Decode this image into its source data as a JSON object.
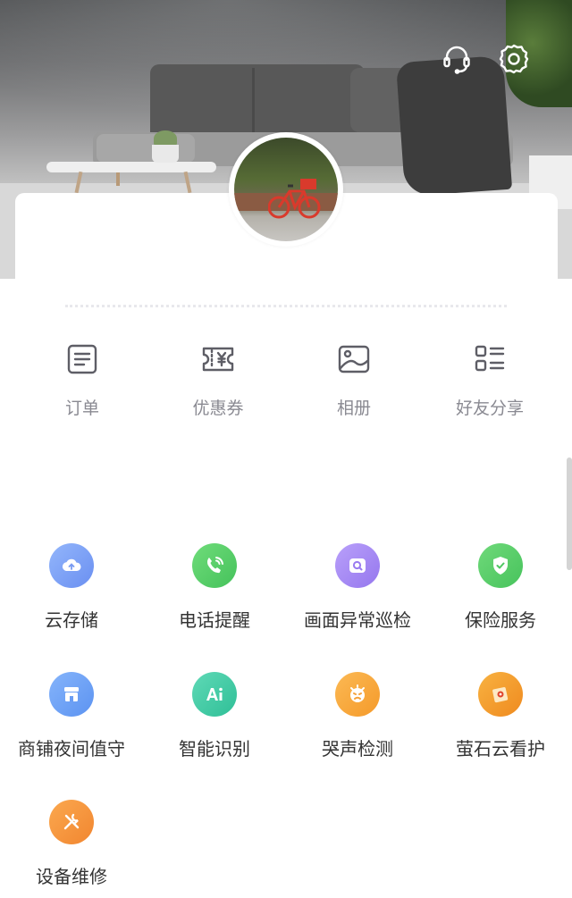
{
  "header": {
    "icons": [
      "headset-icon",
      "settings-icon"
    ]
  },
  "quick_actions": [
    {
      "icon": "orders-icon",
      "label": "订单"
    },
    {
      "icon": "coupon-icon",
      "label": "优惠券"
    },
    {
      "icon": "album-icon",
      "label": "相册"
    },
    {
      "icon": "share-icon",
      "label": "好友分享"
    }
  ],
  "services": [
    {
      "icon": "cloud-storage-icon",
      "label": "云存储",
      "color": "#7fa4f4"
    },
    {
      "icon": "phone-alert-icon",
      "label": "电话提醒",
      "color": "#5bd06c"
    },
    {
      "icon": "screen-check-icon",
      "label": "画面异常巡检",
      "color": "#a98cf3"
    },
    {
      "icon": "shield-icon",
      "label": "保险服务",
      "color": "#58cc67"
    },
    {
      "icon": "store-icon",
      "label": "商铺夜间值守",
      "color": "#6ea4f5"
    },
    {
      "icon": "ai-icon",
      "label": "智能识别",
      "color": "#3fc9a4"
    },
    {
      "icon": "baby-cry-icon",
      "label": "哭声检测",
      "color": "#f7a33c"
    },
    {
      "icon": "ezviz-care-icon",
      "label": "萤石云看护",
      "color": "#f49a2c"
    },
    {
      "icon": "repair-icon",
      "label": "设备维修",
      "color": "#f5923a"
    }
  ],
  "colors": {
    "card_background": "#ffffff",
    "quick_label": "#8a8a92",
    "service_label": "#333333"
  }
}
